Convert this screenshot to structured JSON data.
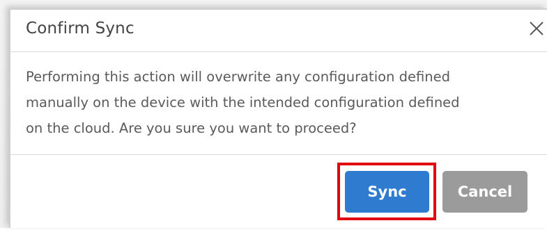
{
  "dialog": {
    "title": "Confirm Sync",
    "close_icon": "close-icon",
    "body_lines": [
      "Performing this action will overwrite any configuration defined",
      "manually on the device with the intended configuration defined",
      "on the cloud. Are you sure you want to proceed?"
    ],
    "sync_label": "Sync",
    "cancel_label": "Cancel"
  },
  "colors": {
    "primary": "#2e7bd0",
    "secondary": "#9b9b9b",
    "highlight": "#e00012",
    "text": "#5a5a5a",
    "title": "#444444"
  }
}
